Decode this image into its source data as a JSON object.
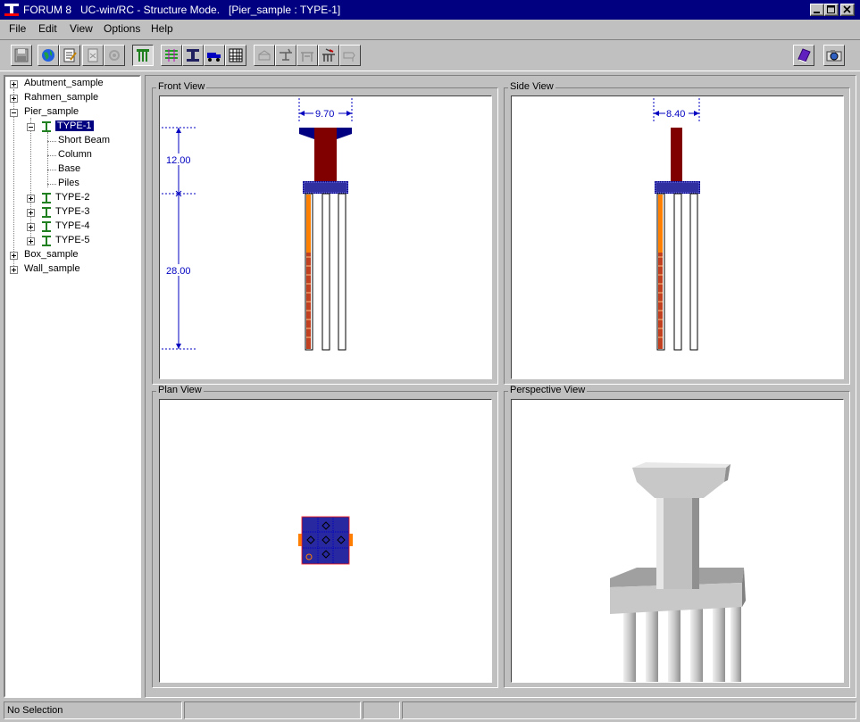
{
  "window": {
    "title": "FORUM 8   UC-win/RC - Structure Mode.   [Pier_sample : TYPE-1]",
    "minimize_icon": "minimize-icon",
    "maximize_icon": "maximize-icon",
    "close_icon": "close-icon"
  },
  "menu": [
    "File",
    "Edit",
    "View",
    "Options",
    "Help"
  ],
  "toolbar": {
    "buttons": [
      "save-icon",
      "globe-icon",
      "edit-page-icon",
      "page-icon",
      "gear-icon",
      "pier-icon",
      "short-beam-icon",
      "column-icon",
      "truck-icon",
      "table-icon",
      "base-icon",
      "section-icon",
      "rebar-icon",
      "pile-icon",
      "load-icon",
      "book-icon",
      "camera-icon"
    ]
  },
  "tree": {
    "roots": [
      {
        "label": "Abutment_sample"
      },
      {
        "label": "Rahmen_sample"
      },
      {
        "label": "Pier_sample",
        "children": [
          {
            "label": "TYPE-1",
            "selected": true,
            "children": [
              "Short Beam",
              "Column",
              "Base",
              "Piles"
            ]
          },
          {
            "label": "TYPE-2"
          },
          {
            "label": "TYPE-3"
          },
          {
            "label": "TYPE-4"
          },
          {
            "label": "TYPE-5"
          }
        ]
      },
      {
        "label": "Box_sample"
      },
      {
        "label": "Wall_sample"
      }
    ]
  },
  "views": {
    "front": {
      "title": "Front View",
      "dim_width": "9.70",
      "dim_top": "12.00",
      "dim_bottom": "28.00"
    },
    "side": {
      "title": "Side View",
      "dim_width": "8.40"
    },
    "plan": {
      "title": "Plan View"
    },
    "perspective": {
      "title": "Perspective View"
    }
  },
  "colors": {
    "column": "#800000",
    "beam": "#000080",
    "base": "#000080",
    "pile_accent": "#ff8000",
    "dimension": "#0000c0"
  },
  "status": {
    "selection": "No Selection"
  }
}
